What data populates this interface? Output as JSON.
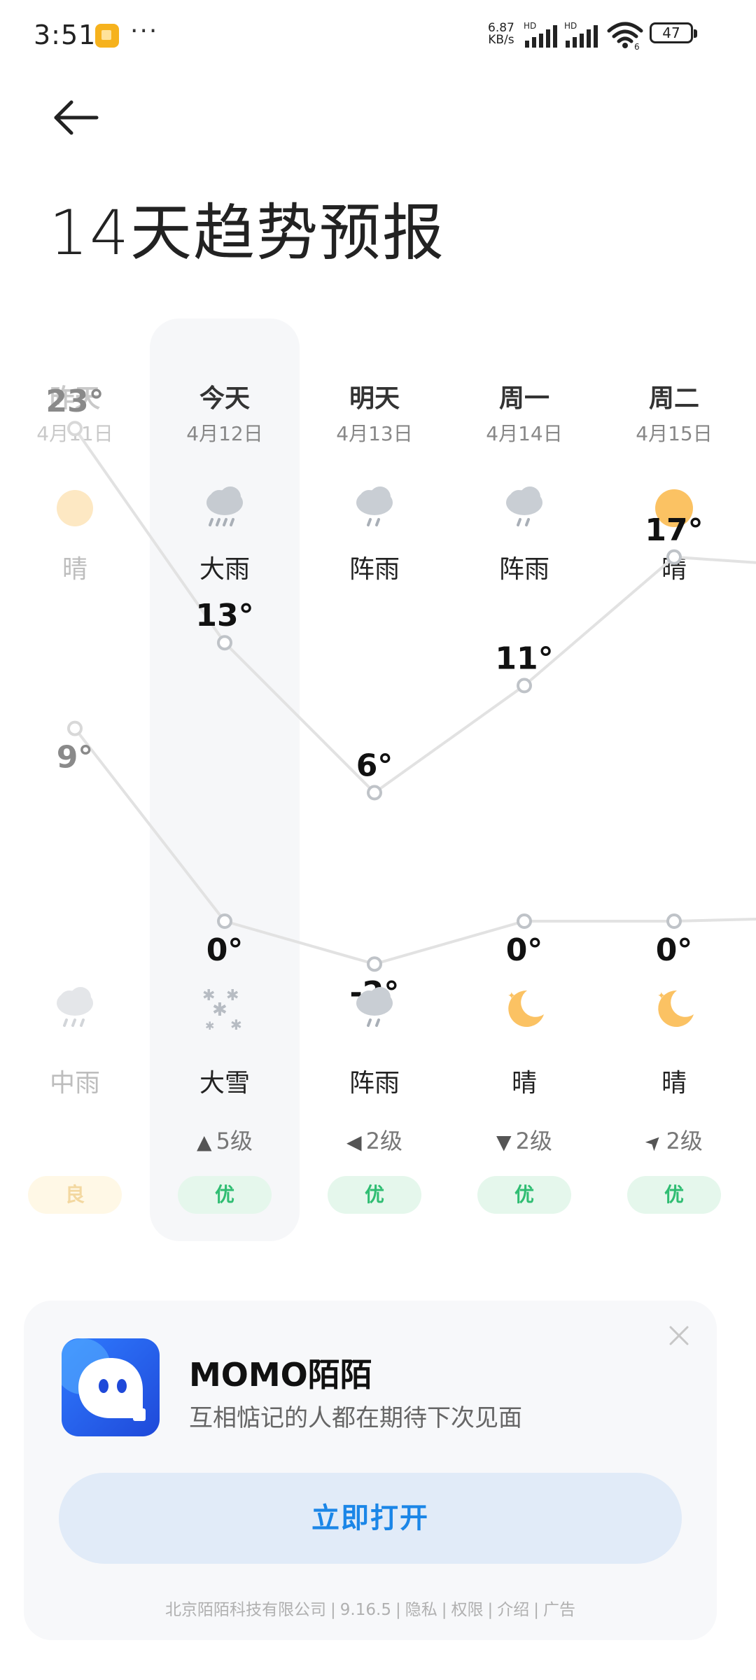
{
  "status_bar": {
    "time": "3:51",
    "net_speed_value": "6.87",
    "net_speed_unit": "KB/s",
    "signal1_label": "HD",
    "signal2_label": "HD",
    "wifi_sub": "6",
    "battery": "47"
  },
  "page": {
    "title": "14天趋势预报"
  },
  "days": [
    {
      "name": "昨天",
      "date": "4月11日",
      "day_icon": "sun-icon",
      "day_cond": "晴",
      "high": "23°",
      "night_icon": "rain-cloud-icon",
      "night_cond": "中雨",
      "low": "9°",
      "wind_dir": "",
      "wind": "",
      "aqi": "良",
      "faded": true
    },
    {
      "name": "今天",
      "date": "4月12日",
      "day_icon": "heavy-rain-icon",
      "day_cond": "大雨",
      "high": "13°",
      "night_icon": "snow-icon",
      "night_cond": "大雪",
      "low": "0°",
      "wind_dir": "▲",
      "wind": "5级",
      "aqi": "优",
      "faded": false
    },
    {
      "name": "明天",
      "date": "4月13日",
      "day_icon": "shower-icon",
      "day_cond": "阵雨",
      "high": "6°",
      "night_icon": "shower-icon",
      "night_cond": "阵雨",
      "low": "-2°",
      "wind_dir": "◀",
      "wind": "2级",
      "aqi": "优",
      "faded": false
    },
    {
      "name": "周一",
      "date": "4月14日",
      "day_icon": "shower-icon",
      "day_cond": "阵雨",
      "high": "11°",
      "night_icon": "moon-icon",
      "night_cond": "晴",
      "low": "0°",
      "wind_dir": "▼",
      "wind": "2级",
      "aqi": "优",
      "faded": false
    },
    {
      "name": "周二",
      "date": "4月15日",
      "day_icon": "sun-icon",
      "day_cond": "晴",
      "high": "17°",
      "night_icon": "moon-icon",
      "night_cond": "晴",
      "low": "0°",
      "wind_dir": "➤",
      "wind": "2级",
      "aqi": "优",
      "faded": false
    }
  ],
  "chart_data": {
    "type": "line",
    "categories": [
      "昨天",
      "今天",
      "明天",
      "周一",
      "周二"
    ],
    "series": [
      {
        "values": [
          23,
          13,
          6,
          11,
          17
        ]
      },
      {
        "values": [
          9,
          0,
          -2,
          0,
          0
        ]
      }
    ]
  },
  "ad": {
    "title": "MOMO陌陌",
    "subtitle": "互相惦记的人都在期待下次见面",
    "cta": "立即打开",
    "footer": [
      "北京陌陌科技有限公司",
      "9.16.5",
      "隐私",
      "权限",
      "介绍",
      "广告"
    ]
  },
  "colors": {
    "good_aqi": "#2fbd72",
    "cta_blue": "#1b86e7",
    "sun": "#fbc263",
    "cloud": "#c9ced4"
  }
}
